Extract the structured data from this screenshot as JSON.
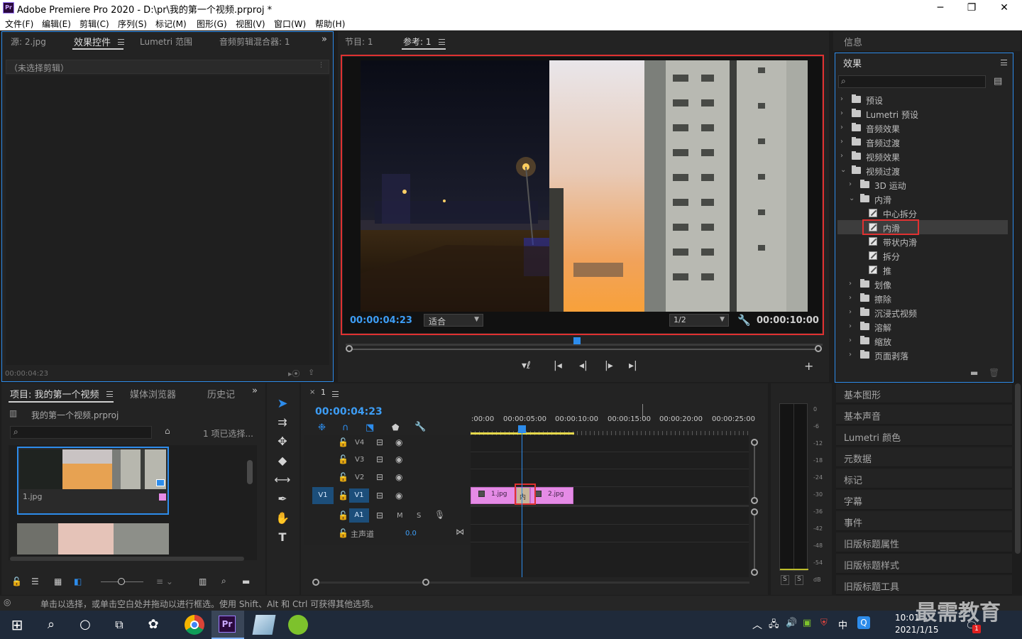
{
  "window": {
    "title": "Adobe Premiere Pro 2020 - D:\\pr\\我的第一个视频.prproj *",
    "app_icon": "Pr",
    "controls": [
      "─",
      "❐",
      "✕"
    ]
  },
  "menu": [
    "文件(F)",
    "编辑(E)",
    "剪辑(C)",
    "序列(S)",
    "标记(M)",
    "图形(G)",
    "视图(V)",
    "窗口(W)",
    "帮助(H)"
  ],
  "source_panel": {
    "tabs": [
      "源: 2.jpg",
      "效果控件",
      "Lumetri 范围",
      "音频剪辑混合器: 1"
    ],
    "active_tab": "效果控件",
    "no_clip_text": "（未选择剪辑）",
    "timecode": "00:00:04:23"
  },
  "program_monitor": {
    "tabs": [
      "节目: 1",
      "参考: 1"
    ],
    "active_tab": "参考: 1",
    "timecode_left": "00:00:04:23",
    "fit": "适合",
    "resolution": "1/2",
    "timecode_right": "00:00:10:00",
    "playhead_fraction": 0.485
  },
  "info_panel": {
    "title": "信息"
  },
  "effects_panel": {
    "title": "效果",
    "search_placeholder": "",
    "tree": [
      {
        "label": "预设",
        "level": 0,
        "type": "folder",
        "open": false,
        "icon": "preset-folder-icon"
      },
      {
        "label": "Lumetri 预设",
        "level": 0,
        "type": "folder",
        "open": false
      },
      {
        "label": "音频效果",
        "level": 0,
        "type": "folder",
        "open": false
      },
      {
        "label": "音频过渡",
        "level": 0,
        "type": "folder",
        "open": false
      },
      {
        "label": "视频效果",
        "level": 0,
        "type": "folder",
        "open": false
      },
      {
        "label": "视频过渡",
        "level": 0,
        "type": "folder",
        "open": true
      },
      {
        "label": "3D 运动",
        "level": 1,
        "type": "folder",
        "open": false
      },
      {
        "label": "内滑",
        "level": 1,
        "type": "folder",
        "open": true
      },
      {
        "label": "中心拆分",
        "level": 2,
        "type": "effect"
      },
      {
        "label": "内滑",
        "level": 2,
        "type": "effect",
        "selected": true
      },
      {
        "label": "带状内滑",
        "level": 2,
        "type": "effect"
      },
      {
        "label": "拆分",
        "level": 2,
        "type": "effect"
      },
      {
        "label": "推",
        "level": 2,
        "type": "effect"
      },
      {
        "label": "划像",
        "level": 1,
        "type": "folder",
        "open": false
      },
      {
        "label": "擦除",
        "level": 1,
        "type": "folder",
        "open": false
      },
      {
        "label": "沉浸式视频",
        "level": 1,
        "type": "folder",
        "open": false
      },
      {
        "label": "溶解",
        "level": 1,
        "type": "folder",
        "open": false
      },
      {
        "label": "缩放",
        "level": 1,
        "type": "folder",
        "open": false
      },
      {
        "label": "页面剥落",
        "level": 1,
        "type": "folder",
        "open": false
      }
    ]
  },
  "right_panels": [
    "基本图形",
    "基本声音",
    "Lumetri 颜色",
    "元数据",
    "标记",
    "字幕",
    "事件",
    "旧版标题属性",
    "旧版标题样式",
    "旧版标题工具"
  ],
  "project_panel": {
    "tabs": [
      "项目: 我的第一个视频",
      "媒体浏览器",
      "历史记"
    ],
    "file": "我的第一个视频.prproj",
    "selected_count": "1 项已选择...",
    "items": [
      {
        "name": "1.jpg"
      },
      {
        "name": ""
      }
    ]
  },
  "timeline": {
    "sequence_name": "1",
    "timecode": "00:00:04:23",
    "ruler": [
      ":00:00",
      "00:00:05:00",
      "00:00:10:00",
      "00:00:15:00",
      "00:00:20:00",
      "00:00:25:00"
    ],
    "tracks": [
      "V4",
      "V3",
      "V2",
      "V1",
      "A1"
    ],
    "track_buttons": {
      "M": "M",
      "S": "S"
    },
    "master": {
      "label": "主声道",
      "value": "0.0"
    },
    "clips": [
      {
        "name": "1.jpg"
      },
      {
        "name": "2.jpg"
      }
    ],
    "transition_label": "内"
  },
  "audio_meter": {
    "scale": [
      "0",
      "-6",
      "-12",
      "-18",
      "-24",
      "-30",
      "-36",
      "-42",
      "-48",
      "-54",
      "dB"
    ],
    "solo": [
      "S",
      "S"
    ]
  },
  "status_bar": "单击以选择，或单击空白处并拖动以进行框选。使用 Shift、Alt 和 Ctrl 可获得其他选项。",
  "taskbar": {
    "time": "10:01",
    "date": "2021/1/15",
    "ime": "中",
    "notify_count": "1",
    "watermark": "最需教育"
  }
}
